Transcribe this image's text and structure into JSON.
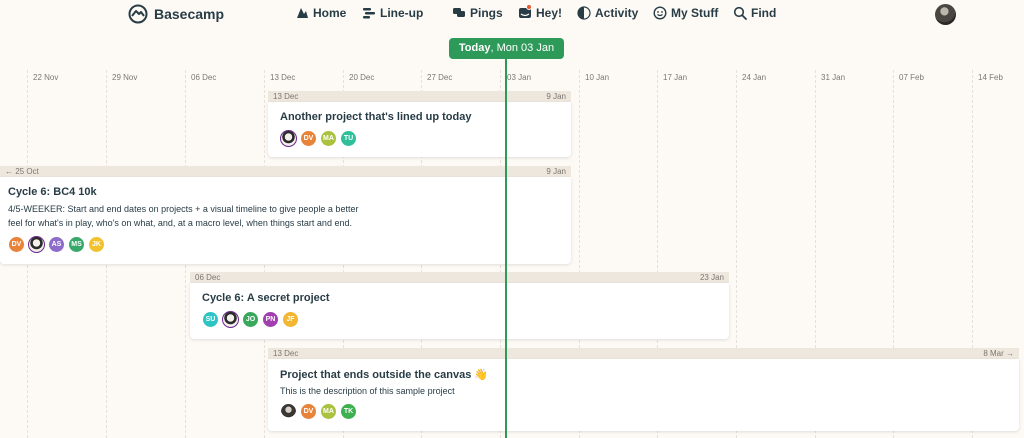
{
  "nav": {
    "brand": "Basecamp",
    "items": [
      {
        "label": "Home",
        "icon": "home-icon"
      },
      {
        "label": "Line-up",
        "icon": "lineup-icon"
      },
      {
        "label": "Pings",
        "icon": "pings-icon"
      },
      {
        "label": "Hey!",
        "icon": "hey-icon"
      },
      {
        "label": "Activity",
        "icon": "activity-icon"
      },
      {
        "label": "My Stuff",
        "icon": "my-stuff-icon"
      },
      {
        "label": "Find",
        "icon": "search-icon"
      }
    ]
  },
  "today": {
    "bold": "Today",
    "rest": ", Mon 03 Jan"
  },
  "dates": [
    "22 Nov",
    "29 Nov",
    "06 Dec",
    "13 Dec",
    "20 Dec",
    "27 Dec",
    "03 Jan",
    "10 Jan",
    "17 Jan",
    "24 Jan",
    "31 Jan",
    "07 Feb",
    "14 Feb"
  ],
  "projects": [
    {
      "start": "13 Dec",
      "end": "9 Jan",
      "title": "Another project that's lined up today",
      "description": "",
      "avatars": [
        "photo",
        "DV",
        "MA",
        "TU"
      ]
    },
    {
      "start": "← 25 Oct",
      "end": "9 Jan",
      "title": "Cycle 6: BC4 10k",
      "description_line1": "4/5-WEEKER: Start and end dates on projects + a visual timeline to give people a better",
      "description_line2": "feel for what's in play, who's on what, and, at a macro level, when things start and end.",
      "avatars": [
        "DV",
        "photo",
        "AS",
        "MS",
        "JK"
      ]
    },
    {
      "start": "06 Dec",
      "end": "23 Jan",
      "title": "Cycle 6: A secret project",
      "description": "",
      "avatars": [
        "SU",
        "photo",
        "JO",
        "PN",
        "JF"
      ]
    },
    {
      "start": "13 Dec",
      "end": "8 Mar →",
      "title": "Project that ends outside the canvas 👋",
      "description": "This is the description of this sample project",
      "avatars": [
        "photo",
        "DV",
        "MA",
        "TK"
      ]
    }
  ],
  "avatar_colors": {
    "DV": "#e8833a",
    "MA": "#a9c23f",
    "TU": "#2fbf9a",
    "AS": "#8e6cc9",
    "MS": "#36a86a",
    "JK": "#f2c22e",
    "SU": "#2ec4c4",
    "JO": "#3aa85c",
    "PN": "#a13fb0",
    "JF": "#f2b632",
    "TK": "#3fb050"
  },
  "accent_color": "#2e9a5a"
}
